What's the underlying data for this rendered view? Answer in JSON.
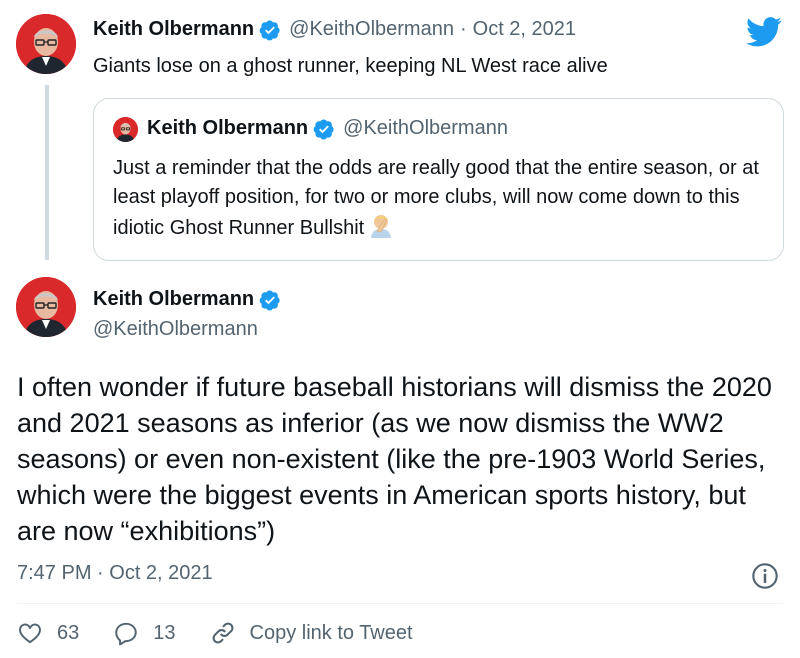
{
  "tweet1": {
    "author_name": "Keith Olbermann",
    "author_handle": "@KeithOlbermann",
    "separator": "·",
    "date": "Oct 2, 2021",
    "text": "Giants lose on a ghost runner, keeping NL West race alive",
    "quoted": {
      "author_name": "Keith Olbermann",
      "author_handle": "@KeithOlbermann",
      "text": "Just a reminder that the odds are really good that the entire season, or at least playoff position, for two or more clubs, will now come down to this idiotic Ghost Runner Bullshit"
    }
  },
  "tweet2": {
    "author_name": "Keith Olbermann",
    "author_handle": "@KeithOlbermann",
    "text": "I often wonder if future baseball historians will dismiss the 2020 and 2021 seasons as inferior (as we now dismiss the WW2 seasons) or even non-existent (like the pre-1903 World Series, which were the biggest events in American sports history, but are now “exhibitions”)",
    "timestamp": "7:47 PM · Oct 2, 2021",
    "likes": "63",
    "replies": "13",
    "copy_link_label": "Copy link to Tweet"
  },
  "colors": {
    "brand": "#1d9bf0",
    "avatar_bg": "#d9292b",
    "muted_text": "#536471",
    "border": "#cfd9de"
  },
  "icons": [
    "twitter-bird-icon",
    "verified-badge-icon",
    "facepalm-emoji-icon",
    "info-icon",
    "heart-icon",
    "reply-icon",
    "link-icon"
  ]
}
